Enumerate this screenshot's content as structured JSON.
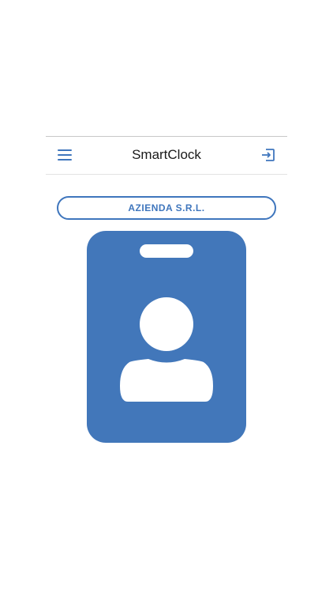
{
  "header": {
    "title": "SmartClock",
    "menu_icon": "hamburger-menu-icon",
    "logout_icon": "logout-icon"
  },
  "company": {
    "label": "AZIENDA S.R.L."
  },
  "badge": {
    "icon": "id-badge-person-icon"
  },
  "colors": {
    "accent": "#3f76bd",
    "badge_fill": "#4277ba",
    "text": "#1a1a1a",
    "background": "#ffffff"
  }
}
